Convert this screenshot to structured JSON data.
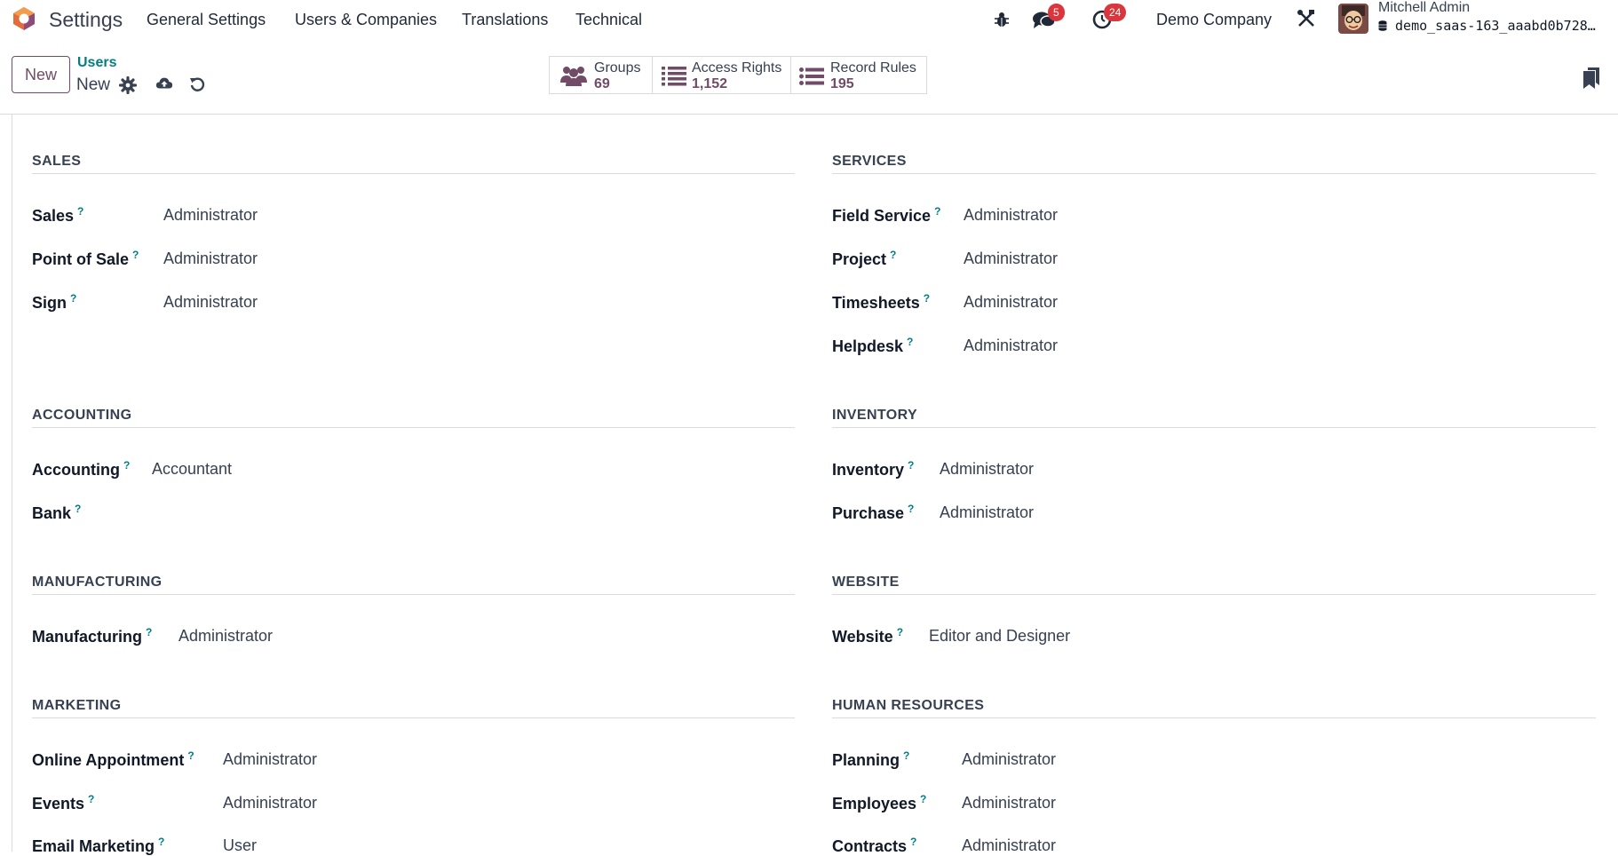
{
  "navbar": {
    "app_name": "Settings",
    "menu": [
      "General Settings",
      "Users & Companies",
      "Translations",
      "Technical"
    ],
    "messages_count": "5",
    "activities_count": "24",
    "company": "Demo Company",
    "user_name": "Mitchell Admin",
    "database": "demo_saas-163_aaabd0b728…",
    "brand_color": "#714b67",
    "badge_color": "#d9363e"
  },
  "control_panel": {
    "new_label": "New",
    "breadcrumb_parent": "Users",
    "breadcrumb_current": "New",
    "stats": [
      {
        "label": "Groups",
        "value": "69"
      },
      {
        "label": "Access Rights",
        "value": "1,152"
      },
      {
        "label": "Record Rules",
        "value": "195"
      }
    ]
  },
  "help_mark": "?",
  "sections": {
    "sales": {
      "title": "SALES",
      "fields": [
        {
          "label": "Sales",
          "value": "Administrator"
        },
        {
          "label": "Point of Sale",
          "value": "Administrator"
        },
        {
          "label": "Sign",
          "value": "Administrator"
        }
      ]
    },
    "services": {
      "title": "SERVICES",
      "fields": [
        {
          "label": "Field Service",
          "value": "Administrator"
        },
        {
          "label": "Project",
          "value": "Administrator"
        },
        {
          "label": "Timesheets",
          "value": "Administrator"
        },
        {
          "label": "Helpdesk",
          "value": "Administrator"
        }
      ]
    },
    "accounting": {
      "title": "ACCOUNTING",
      "fields": [
        {
          "label": "Accounting",
          "value": "Accountant"
        },
        {
          "label": "Bank",
          "value": ""
        }
      ]
    },
    "inventory": {
      "title": "INVENTORY",
      "fields": [
        {
          "label": "Inventory",
          "value": "Administrator"
        },
        {
          "label": "Purchase",
          "value": "Administrator"
        }
      ]
    },
    "manufacturing": {
      "title": "MANUFACTURING",
      "fields": [
        {
          "label": "Manufacturing",
          "value": "Administrator"
        }
      ]
    },
    "website": {
      "title": "WEBSITE",
      "fields": [
        {
          "label": "Website",
          "value": "Editor and Designer"
        }
      ]
    },
    "marketing": {
      "title": "MARKETING",
      "fields": [
        {
          "label": "Online Appointment",
          "value": "Administrator"
        },
        {
          "label": "Events",
          "value": "Administrator"
        },
        {
          "label": "Email Marketing",
          "value": "User"
        }
      ]
    },
    "hr": {
      "title": "HUMAN RESOURCES",
      "fields": [
        {
          "label": "Planning",
          "value": "Administrator"
        },
        {
          "label": "Employees",
          "value": "Administrator"
        },
        {
          "label": "Contracts",
          "value": "Administrator"
        }
      ]
    }
  }
}
